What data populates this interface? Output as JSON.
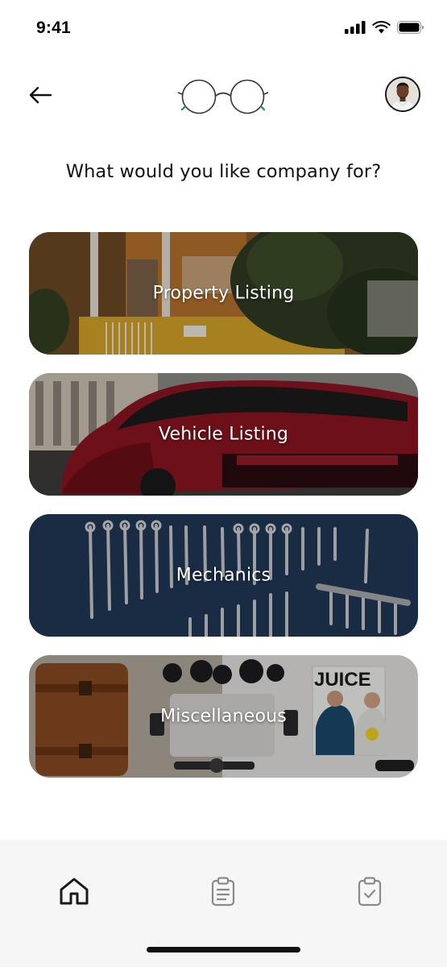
{
  "status_bar": {
    "time": "9:41",
    "icons": [
      "cellular-signal-icon",
      "wifi-icon",
      "battery-icon"
    ]
  },
  "header": {
    "back_icon": "arrow-left-icon",
    "logo_icon": "round-glasses-logo-icon",
    "avatar": "user-avatar-photo"
  },
  "title": "What would you like company for?",
  "categories": [
    {
      "label": "Property Listing",
      "image": "house-with-yellow-gate-and-tree-photo"
    },
    {
      "label": "Vehicle Listing",
      "image": "red-sports-car-photo"
    },
    {
      "label": "Mechanics",
      "image": "wrenches-on-pegboard-photo"
    },
    {
      "label": "Miscellaneous",
      "image": "desk-flatlay-with-bag-laptop-magazine-photo"
    }
  ],
  "misc_magazine_text": "JUICE",
  "bottom_nav": {
    "items": [
      {
        "icon": "home-icon",
        "active": true
      },
      {
        "icon": "clipboard-list-icon",
        "active": false
      },
      {
        "icon": "clipboard-check-icon",
        "active": false
      }
    ]
  },
  "colors": {
    "background": "#ffffff",
    "text": "#111111",
    "nav_background": "#f6f6f6",
    "nav_active": "#1a1a1a",
    "nav_inactive": "#8a8a8a"
  }
}
